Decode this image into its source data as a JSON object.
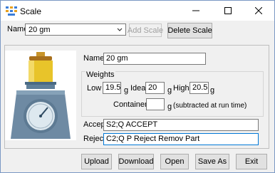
{
  "window": {
    "title": "Scale"
  },
  "titlebar_buttons": {
    "minimize": "—",
    "maximize": "☐",
    "close": "✕"
  },
  "top": {
    "name_label": "Name",
    "name_selected": "20 gm",
    "add_scale": "Add Scale",
    "delete_scale": "Delete Scale"
  },
  "form": {
    "name_label": "Name",
    "name_value": "20 gm",
    "weights_label": "Weights",
    "low_label": "Low",
    "low_value": "19.5",
    "low_unit": "g",
    "ideal_label": "Ideal",
    "ideal_value": "20",
    "ideal_unit": "g",
    "high_label": "High",
    "high_value": "20.5",
    "high_unit": "g",
    "container_label": "Container",
    "container_value": "",
    "container_unit": "g",
    "container_note": "(subtracted at run time)",
    "accept_label": "Accept",
    "accept_value": "S2;Q ACCEPT",
    "reject_label": "Reject",
    "reject_value": "C2;Q P Reject Remov Part"
  },
  "buttons": {
    "upload": "Upload",
    "download": "Download",
    "open": "Open",
    "save_as": "Save As",
    "exit": "Exit"
  },
  "icons": {
    "app": "scale-app-icon",
    "scale_image": "scale-illustration",
    "dropdown": "chevron-down-icon"
  }
}
